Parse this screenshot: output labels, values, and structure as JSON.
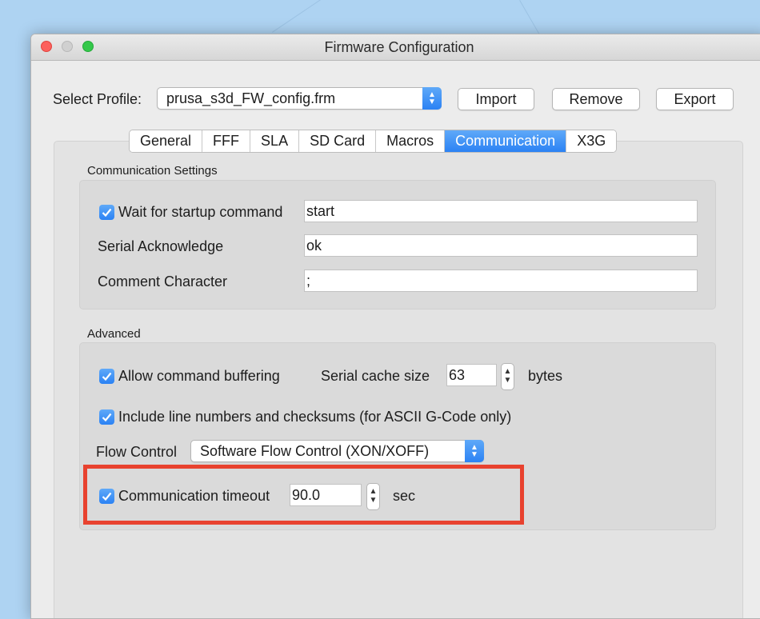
{
  "window": {
    "title": "Firmware Configuration"
  },
  "profile": {
    "label": "Select Profile:",
    "value": "prusa_s3d_FW_config.frm",
    "import_label": "Import",
    "remove_label": "Remove",
    "export_label": "Export"
  },
  "tabs": [
    {
      "label": "General",
      "active": false
    },
    {
      "label": "FFF",
      "active": false
    },
    {
      "label": "SLA",
      "active": false
    },
    {
      "label": "SD Card",
      "active": false
    },
    {
      "label": "Macros",
      "active": false
    },
    {
      "label": "Communication",
      "active": true
    },
    {
      "label": "X3G",
      "active": false
    }
  ],
  "comm_settings": {
    "title": "Communication Settings",
    "wait_startup": {
      "label": "Wait for startup command",
      "checked": true,
      "value": "start"
    },
    "serial_ack": {
      "label": "Serial Acknowledge",
      "value": "ok"
    },
    "comment_char": {
      "label": "Comment Character",
      "value": ";"
    }
  },
  "advanced": {
    "title": "Advanced",
    "allow_buffering": {
      "label": "Allow command buffering",
      "checked": true
    },
    "cache_size": {
      "label": "Serial cache size",
      "value": "63",
      "unit": "bytes"
    },
    "line_numbers": {
      "label": "Include line numbers and checksums (for ASCII G-Code only)",
      "checked": true
    },
    "flow_control": {
      "label": "Flow Control",
      "value": "Software Flow Control (XON/XOFF)"
    },
    "timeout": {
      "label": "Communication timeout",
      "checked": true,
      "value": "90.0",
      "unit": "sec"
    }
  },
  "colors": {
    "accent": "#2b82f4",
    "highlight_box": "#e8422f",
    "desktop": "#aed3f2"
  }
}
